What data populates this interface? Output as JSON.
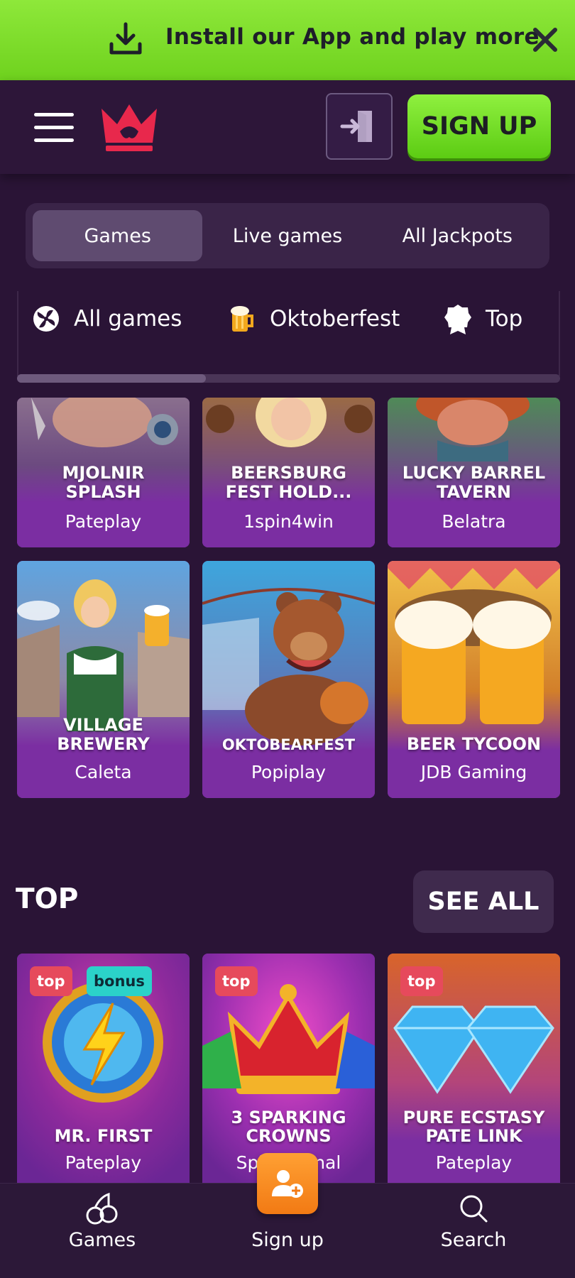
{
  "install_bar": {
    "text": "Install our App and play more"
  },
  "header": {
    "signup_label": "SIGN UP"
  },
  "tabs": [
    {
      "label": "Games",
      "active": true
    },
    {
      "label": "Live games",
      "active": false
    },
    {
      "label": "All Jackpots",
      "active": false
    }
  ],
  "categories": [
    {
      "label": "All games",
      "icon": "pinwheel-icon"
    },
    {
      "label": "Oktoberfest",
      "icon": "beer-mug-icon"
    },
    {
      "label": "Top",
      "icon": "award-icon"
    }
  ],
  "games_grid": [
    {
      "title_1": "MJOLNIR",
      "title_2": "SPLASH",
      "provider": "Pateplay"
    },
    {
      "title_1": "BEERSBURG",
      "title_2": "FEST HOLD...",
      "provider": "1spin4win"
    },
    {
      "title_1": "LUCKY BARREL",
      "title_2": "TAVERN",
      "provider": "Belatra"
    },
    {
      "title_1": "VILLAGE",
      "title_2": "BREWERY",
      "provider": "Caleta"
    },
    {
      "title_1": "",
      "title_2": "OKTOBEARFEST",
      "provider": "Popiplay"
    },
    {
      "title_1": "",
      "title_2": "BEER TYCOON",
      "provider": "JDB Gaming"
    }
  ],
  "top_section": {
    "title": "TOP",
    "see_all": "SEE ALL",
    "games": [
      {
        "title_1": "",
        "title_2": "MR. FIRST",
        "provider": "Pateplay",
        "badges": [
          "top",
          "bonus"
        ]
      },
      {
        "title_1": "3 SPARKING",
        "title_2": "CROWNS",
        "provider": "Spinomenal",
        "badges": [
          "top"
        ]
      },
      {
        "title_1": "PURE ECSTASY",
        "title_2": "PATE LINK",
        "provider": "Pateplay",
        "badges": [
          "top"
        ]
      }
    ]
  },
  "bottom_nav": {
    "games": "Games",
    "signup": "Sign up",
    "search": "Search"
  },
  "colors": {
    "background": "#2a1436",
    "green": "#7ddc2a",
    "card": "#7b2ea2",
    "badge_top": "#e64a5c",
    "badge_bonus": "#2bd2c9",
    "orange": "#f58a1f"
  }
}
